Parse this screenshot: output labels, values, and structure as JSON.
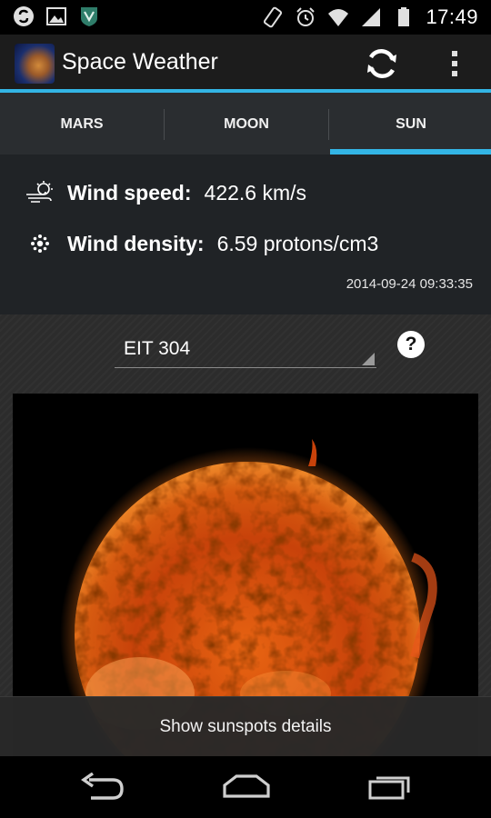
{
  "status_bar": {
    "time": "17:49",
    "left_icons": [
      "sync-s-icon",
      "image-icon",
      "shield-icon"
    ],
    "right_icons": [
      "rotate-phone-icon",
      "alarm-clock-icon",
      "wifi-icon",
      "signal-icon",
      "battery-icon"
    ]
  },
  "action_bar": {
    "title": "Space Weather",
    "icons": [
      "app-logo",
      "refresh-icon",
      "overflow-menu-icon"
    ],
    "accent_color": "#33b5e5"
  },
  "tabs": {
    "items": [
      {
        "label": "MARS"
      },
      {
        "label": "MOON"
      },
      {
        "label": "SUN"
      }
    ],
    "selected": "SUN"
  },
  "info": {
    "wind_speed_label": "Wind speed:",
    "wind_speed_value": "422.6 km/s",
    "wind_density_label": "Wind density:",
    "wind_density_value": "6.59 protons/cm3",
    "timestamp": "2014-09-24 09:33:35"
  },
  "image_select": {
    "selected": "EIT 304",
    "help_label": "?"
  },
  "details_button": {
    "label": "Show sunspots details"
  },
  "nav_bar": {
    "icons": [
      "back-icon",
      "home-icon",
      "recents-icon"
    ]
  }
}
